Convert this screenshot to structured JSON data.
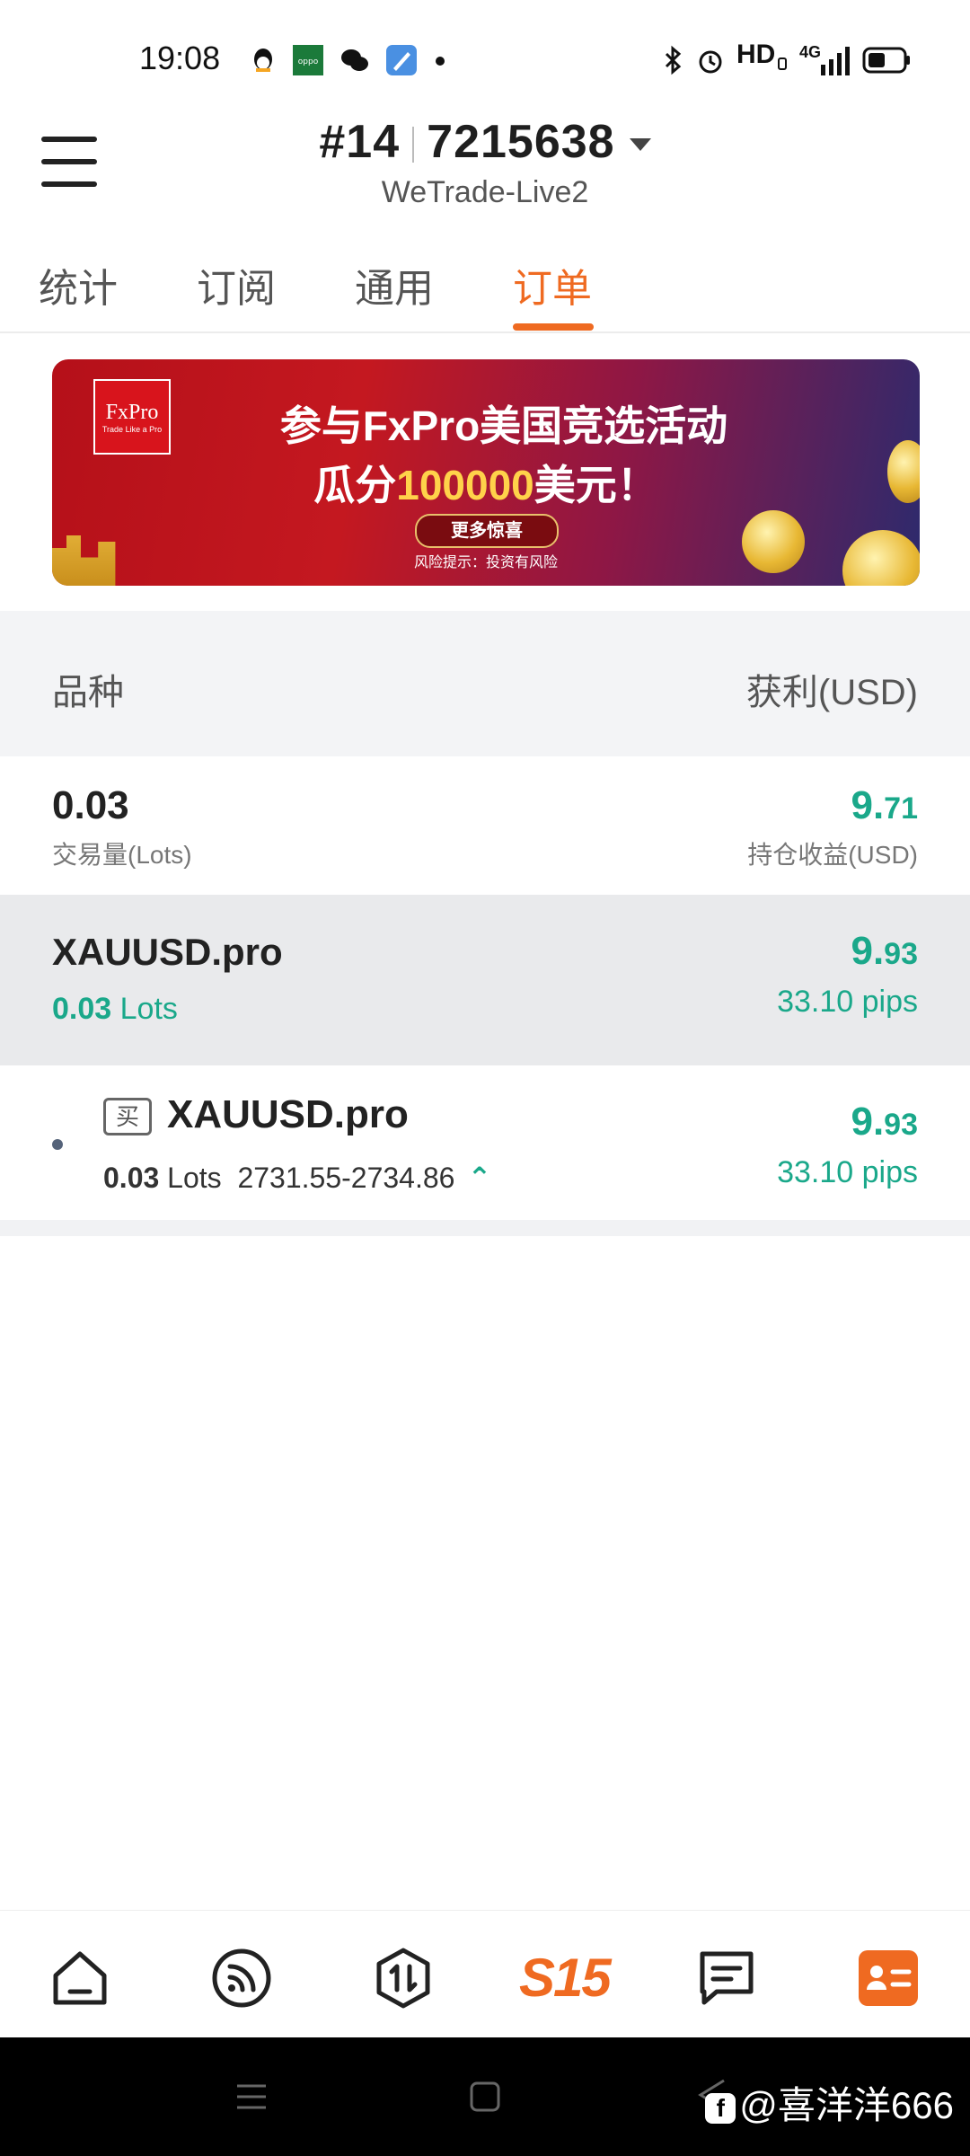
{
  "status_bar": {
    "time": "19:08",
    "right_text": "HD",
    "network": "4G"
  },
  "header": {
    "account_prefix": "#14",
    "account_number": "7215638",
    "server": "WeTrade-Live2"
  },
  "tabs": [
    {
      "label": "统计",
      "active": false
    },
    {
      "label": "订阅",
      "active": false
    },
    {
      "label": "通用",
      "active": false
    },
    {
      "label": "订单",
      "active": true
    }
  ],
  "banner": {
    "logo_text": "FxPro",
    "logo_tagline": "Trade Like a Pro",
    "line1": "参与FxPro美国竞选活动",
    "line2_prefix": "瓜分",
    "line2_amount": "100000",
    "line2_suffix": "美元！",
    "button": "更多惊喜",
    "risk": "风险提示：投资有风险"
  },
  "columns": {
    "left": "品种",
    "right": "获利(USD)"
  },
  "summary": {
    "lots": "0.03",
    "lots_label": "交易量(Lots)",
    "profit_int": "9.",
    "profit_dec": "71",
    "profit_label": "持仓收益(USD)"
  },
  "group": {
    "symbol": "XAUUSD.pro",
    "lots": "0.03",
    "lots_unit": "Lots",
    "profit_int": "9.",
    "profit_dec": "93",
    "pips": "33.10 pips"
  },
  "order": {
    "side_badge": "买",
    "symbol": "XAUUSD.pro",
    "lots": "0.03",
    "lots_unit": "Lots",
    "price_range": "2731.55-2734.86",
    "profit_int": "9.",
    "profit_dec": "93",
    "pips": "33.10 pips"
  },
  "bottom_nav": {
    "center_label": "S15"
  },
  "watermark": "@喜洋洋666",
  "colors": {
    "accent": "#ef6a21",
    "profit_green": "#1aa88a"
  }
}
